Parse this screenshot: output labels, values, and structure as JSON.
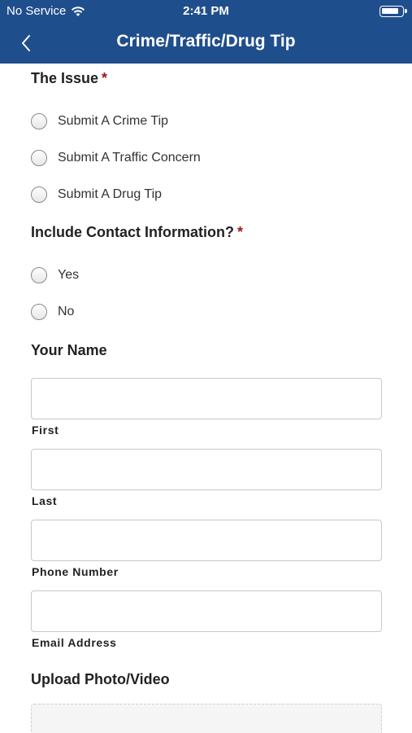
{
  "status": {
    "carrier": "No Service",
    "time": "2:41 PM"
  },
  "nav": {
    "title": "Crime/Traffic/Drug Tip"
  },
  "issue": {
    "heading": "The Issue",
    "required": "*",
    "options": [
      "Submit A Crime Tip",
      "Submit A Traffic Concern",
      "Submit A Drug Tip"
    ]
  },
  "contact": {
    "heading": "Include Contact Information?",
    "required": "*",
    "options": [
      "Yes",
      "No"
    ]
  },
  "name": {
    "heading": "Your Name",
    "first_label": "First",
    "last_label": "Last"
  },
  "phone": {
    "label": "Phone Number"
  },
  "email": {
    "label": "Email Address"
  },
  "upload": {
    "heading": "Upload Photo/Video"
  }
}
